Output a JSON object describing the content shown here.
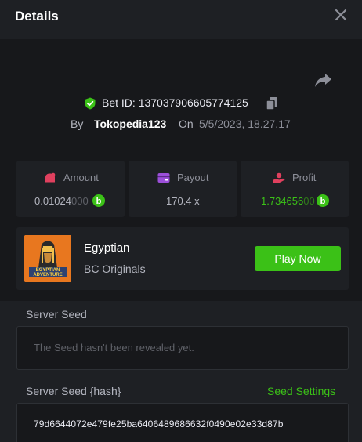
{
  "header": {
    "title": "Details"
  },
  "bet": {
    "id_label": "Bet ID:",
    "id_value": "137037906605774125",
    "by_label": "By",
    "username": "Tokopedia123",
    "on_label": "On",
    "datetime": "5/5/2023, 18.27.17"
  },
  "stats": {
    "amount": {
      "label": "Amount",
      "value_main": "0.01024",
      "value_tail": "000",
      "icon": "money-bag-icon"
    },
    "payout": {
      "label": "Payout",
      "value": "170.4 x",
      "icon": "wallet-icon"
    },
    "profit": {
      "label": "Profit",
      "value_main": "1.734656",
      "value_tail": "00",
      "icon": "hand-coin-icon"
    }
  },
  "game": {
    "name": "Egyptian",
    "provider": "BC Originals",
    "thumb_text": "EGYPTIAN ADVENTURE",
    "play_label": "Play Now"
  },
  "seed": {
    "server_seed_label": "Server Seed",
    "server_seed_placeholder": "The Seed hasn't been revealed yet.",
    "hash_label": "Server Seed {hash}",
    "settings_label": "Seed Settings",
    "hash_value": "79d6644072e479fe25ba6406489686632f0490e02e33d87b"
  },
  "colors": {
    "accent_green": "#3bc117",
    "shield_green": "#3bc117",
    "amount_icon": "#e0405e",
    "payout_icon": "#9c4fd9",
    "profit_icon": "#e0405e",
    "coin": "#3bc117",
    "thumb_bg": "#e8771f"
  }
}
